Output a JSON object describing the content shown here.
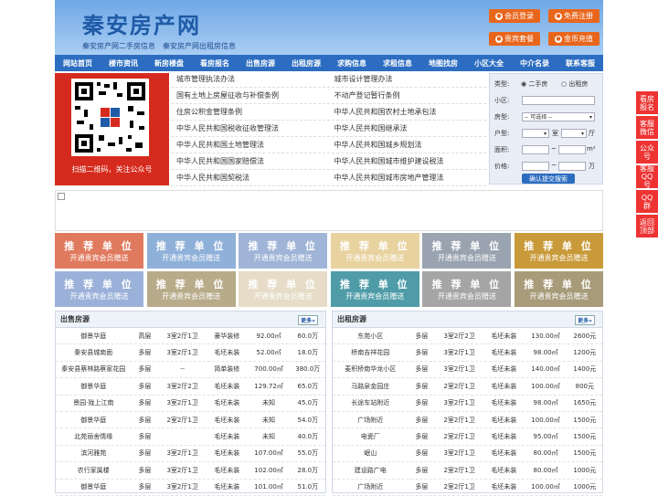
{
  "header": {
    "logo": "秦安房产网",
    "slogan": "秦安房产网二手房信息　秦安房产网出租房信息",
    "buttons": [
      "会员登录",
      "免费注册",
      "贵宾套餐",
      "金币充值"
    ]
  },
  "nav": [
    "网站首页",
    "楼市资讯",
    "新房楼盘",
    "看房报名",
    "出售房源",
    "出租房源",
    "求购信息",
    "求租信息",
    "地图找房",
    "小区大全",
    "中介名录",
    "联系客服"
  ],
  "qr_caption": "扫描二维码，关注公众号",
  "links": [
    [
      "城市管理执法办法",
      "城市设计管理办法"
    ],
    [
      "国有土地上房屋征收与补偿条例",
      "不动产登记暂行条例"
    ],
    [
      "住房公积金管理条例",
      "中华人民共和国农村土地承包法"
    ],
    [
      "中华人民共和国税收征收管理法",
      "中华人民共和国继承法"
    ],
    [
      "中华人民共和国土地管理法",
      "中华人民共和国城乡规划法"
    ],
    [
      "中华人民共和国国家赔偿法",
      "中华人民共和国城市维护建设税法"
    ],
    [
      "中华人民共和国契税法",
      "中华人民共和国城市房地产管理法"
    ]
  ],
  "search": {
    "type_label": "类型:",
    "type_opt1": "二手房",
    "type_opt2": "出租房",
    "community_label": "小区:",
    "house_label": "房型:",
    "house_select": "-- 可选择 --",
    "layout_label": "户型:",
    "room": "室",
    "hall": "厅",
    "area_label": "面积:",
    "price_label": "价格:",
    "tilde": "~",
    "area_unit": "m²",
    "price_unit": "万",
    "submit": "确认提交搜索"
  },
  "tiles": {
    "title": "推 荐 单 位",
    "sub": "开通贵宾会员赠送",
    "colors": [
      "#e07a5f",
      "#8fb0d8",
      "#9fb4d6",
      "#e8d3a0",
      "#9aa3b0",
      "#c99a3a",
      "#9bb1d9",
      "#b8ab8a",
      "#e6dcc7",
      "#4f9ca8",
      "#a5a5a5",
      "#a89b7a"
    ]
  },
  "sale": {
    "title": "出售房源",
    "more": "更多»",
    "rows": [
      [
        "御景华庭",
        "高层",
        "3室2厅1卫",
        "豪华装修",
        "92.00㎡",
        "60.0万"
      ],
      [
        "秦安县城南面",
        "多层",
        "3室2厅1卫",
        "毛坯未装",
        "52.00㎡",
        "18.0万"
      ],
      [
        "秦安县蔡林路蔡家花园",
        "多层",
        "--",
        "简单装修",
        "700.00㎡",
        "380.0万"
      ],
      [
        "御景华庭",
        "多层",
        "3室2厅2卫",
        "毛坯未装",
        "129.72㎡",
        "65.0万"
      ],
      [
        "景园·陇上江南",
        "多层",
        "3室2厅1卫",
        "毛坯未装",
        "未知",
        "45.0万"
      ],
      [
        "御景华庭",
        "多层",
        "2室2厅1卫",
        "毛坯未装",
        "未知",
        "54.0万"
      ],
      [
        "北苑丽舍情缘",
        "多层",
        "",
        "毛坯未装",
        "未知",
        "40.0万"
      ],
      [
        "滨河雅苑",
        "多层",
        "3室2厅1卫",
        "毛坯未装",
        "107.00㎡",
        "55.0万"
      ],
      [
        "农行家属楼",
        "多层",
        "3室2厅1卫",
        "毛坯未装",
        "102.00㎡",
        "28.0万"
      ],
      [
        "御景华庭",
        "多层",
        "3室2厅1卫",
        "毛坯未装",
        "101.00㎡",
        "51.0万"
      ]
    ]
  },
  "rent": {
    "title": "出租房源",
    "more": "更多»",
    "rows": [
      [
        "东苑小区",
        "多层",
        "3室2厅2卫",
        "毛坯未装",
        "130.00㎡",
        "2600元"
      ],
      [
        "桥南吉祥花园",
        "多层",
        "3室2厅1卫",
        "毛坯未装",
        "98.00㎡",
        "1200元"
      ],
      [
        "麦积桥南华龙小区",
        "多层",
        "3室2厅1卫",
        "毛坯未装",
        "140.00㎡",
        "1400元"
      ],
      [
        "马路泉金园庄",
        "多层",
        "2室2厅1卫",
        "毛坯未装",
        "100.00㎡",
        "800元"
      ],
      [
        "长途车站附近",
        "多层",
        "3室2厅1卫",
        "毛坯未装",
        "98.00㎡",
        "1650元"
      ],
      [
        "广场附近",
        "多层",
        "2室2厅1卫",
        "毛坯未装",
        "100.00㎡",
        "1500元"
      ],
      [
        "电瓷厂",
        "多层",
        "2室2厅1卫",
        "毛坯未装",
        "95.00㎡",
        "1500元"
      ],
      [
        "岷山",
        "多层",
        "3室2厅1卫",
        "毛坯未装",
        "80.00㎡",
        "1500元"
      ],
      [
        "建设路广电",
        "多层",
        "2室2厅1卫",
        "毛坯未装",
        "80.00㎡",
        "1000元"
      ],
      [
        "广场附近",
        "多层",
        "2室2厅1卫",
        "毛坯未装",
        "100.00㎡",
        "1000元"
      ]
    ]
  },
  "side": [
    "看房报名",
    "客服微信",
    "公众号",
    "客服QQ号",
    "QQ群",
    "返回顶部"
  ]
}
